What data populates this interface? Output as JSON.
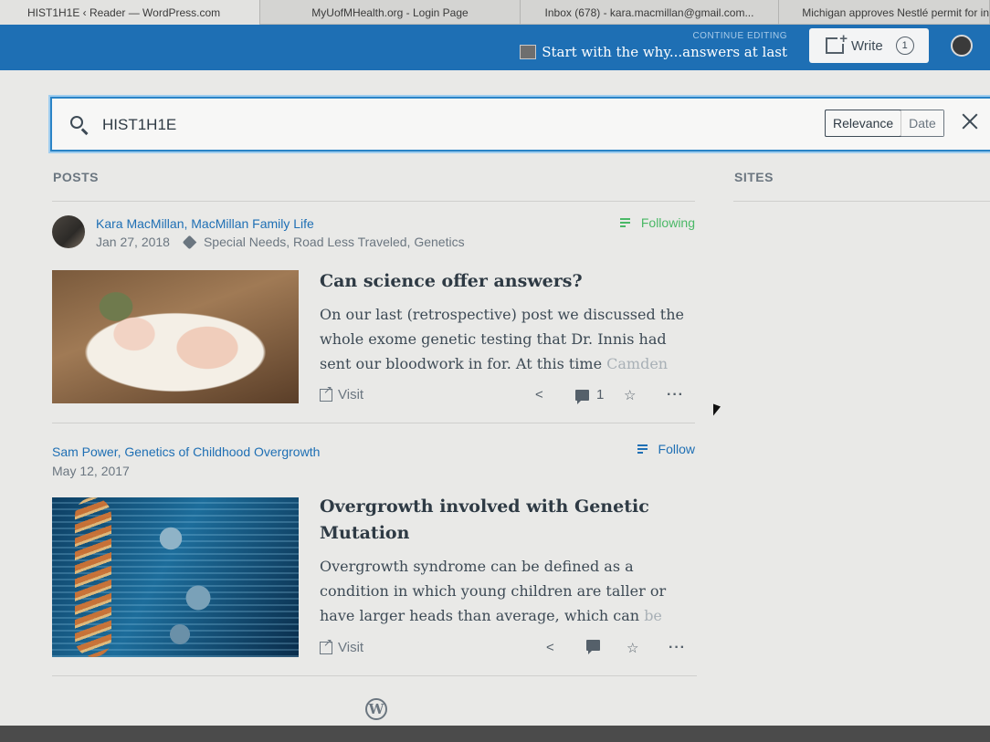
{
  "browser": {
    "tabs": [
      {
        "title": "HIST1H1E ‹ Reader — WordPress.com"
      },
      {
        "title": "MyUofMHealth.org - Login Page"
      },
      {
        "title": "Inbox (678) - kara.macmillan@gmail.com..."
      },
      {
        "title": "Michigan approves Nestlé permit for in"
      }
    ]
  },
  "masterbar": {
    "continue_label": "CONTINUE EDITING",
    "continue_title": "Start with the why...answers at last",
    "write_label": "Write",
    "draft_count": "1"
  },
  "search": {
    "query": "HIST1H1E",
    "sort_relevance": "Relevance",
    "sort_date": "Date",
    "sort_selected": "Relevance"
  },
  "columns": {
    "posts": "POSTS",
    "sites": "SITES"
  },
  "posts": [
    {
      "author": "Kara MacMillan, MacMillan Family Life",
      "date": "Jan 27, 2018",
      "tags": "Special Needs, Road Less Traveled, Genetics",
      "follow_label": "Following",
      "title": "Can science offer answers?",
      "excerpt": "On our last (retrospective) post we discussed the whole exome genetic testing that Dr. Innis had sent our bloodwork in for. At this time",
      "excerpt_fade": "Camden",
      "visit_label": "Visit",
      "comment_count": "1"
    },
    {
      "author": "Sam Power, Genetics of Childhood Overgrowth",
      "date": "May 12, 2017",
      "follow_label": "Follow",
      "title": "Overgrowth involved with Genetic Mutation",
      "excerpt": "Overgrowth syndrome can be defined as a condition in which young children are taller or have larger heads than average, which can",
      "excerpt_fade": "be",
      "visit_label": "Visit",
      "comment_count": ""
    }
  ],
  "colors": {
    "masterbar": "#1e6fb4",
    "link": "#1e6fb4",
    "following": "#4ab866"
  }
}
